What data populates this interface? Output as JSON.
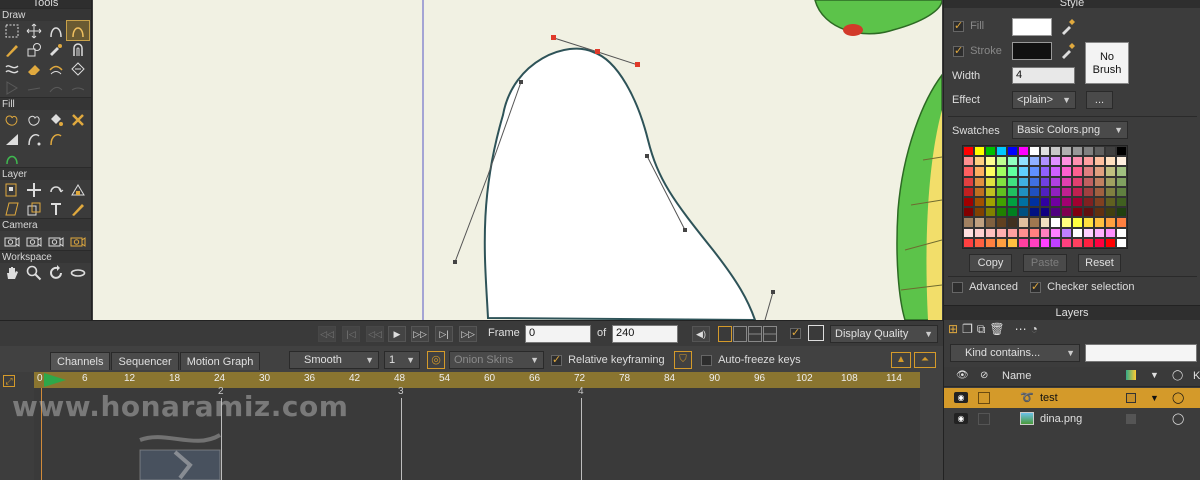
{
  "tools_panel": {
    "title": "Tools",
    "sections": [
      "Draw",
      "Fill",
      "Layer",
      "Camera",
      "Workspace"
    ]
  },
  "style_panel": {
    "title": "Style",
    "fill_label": "Fill",
    "fill_color": "#ffffff",
    "stroke_label": "Stroke",
    "stroke_color": "#111111",
    "no_brush_label": "No\nBrush",
    "width_label": "Width",
    "width_value": "4",
    "effect_label": "Effect",
    "effect_value": "<plain>",
    "effect_more": "...",
    "swatches_label": "Swatches",
    "swatches_value": "Basic Colors.png",
    "copy_label": "Copy",
    "paste_label": "Paste",
    "reset_label": "Reset",
    "advanced_label": "Advanced",
    "checker_label": "Checker selection"
  },
  "layers_panel": {
    "title": "Layers",
    "filter_value": "Kind contains...",
    "column_name": "Name",
    "column_k": "K",
    "layers": [
      {
        "name": "test",
        "selected": true
      },
      {
        "name": "dina.png",
        "selected": false
      }
    ]
  },
  "playbar": {
    "frame_label": "Frame",
    "frame_value": "0",
    "of_label": "of",
    "total_frames": "240",
    "display_quality": "Display Quality"
  },
  "timeline": {
    "tabs": [
      "Channels",
      "Sequencer",
      "Motion Graph"
    ],
    "interpolation": "Smooth",
    "interp_step": "1",
    "onion_skins": "Onion Skins",
    "relative_keyframing": "Relative keyframing",
    "auto_freeze": "Auto-freeze keys",
    "ruler_labels": [
      "0",
      "6",
      "12",
      "18",
      "24",
      "30",
      "36",
      "42",
      "48",
      "54",
      "60",
      "66",
      "72",
      "78",
      "84",
      "90",
      "96",
      "102",
      "108",
      "114"
    ],
    "second_labels": [
      "2",
      "3",
      "4"
    ]
  },
  "watermark": "www.honaramiz.com",
  "colors": {
    "accent": "#d49a2a",
    "canvas_bg": "#f1f1e3",
    "ruler": "#8a7530",
    "handle": "#e03a2a"
  }
}
